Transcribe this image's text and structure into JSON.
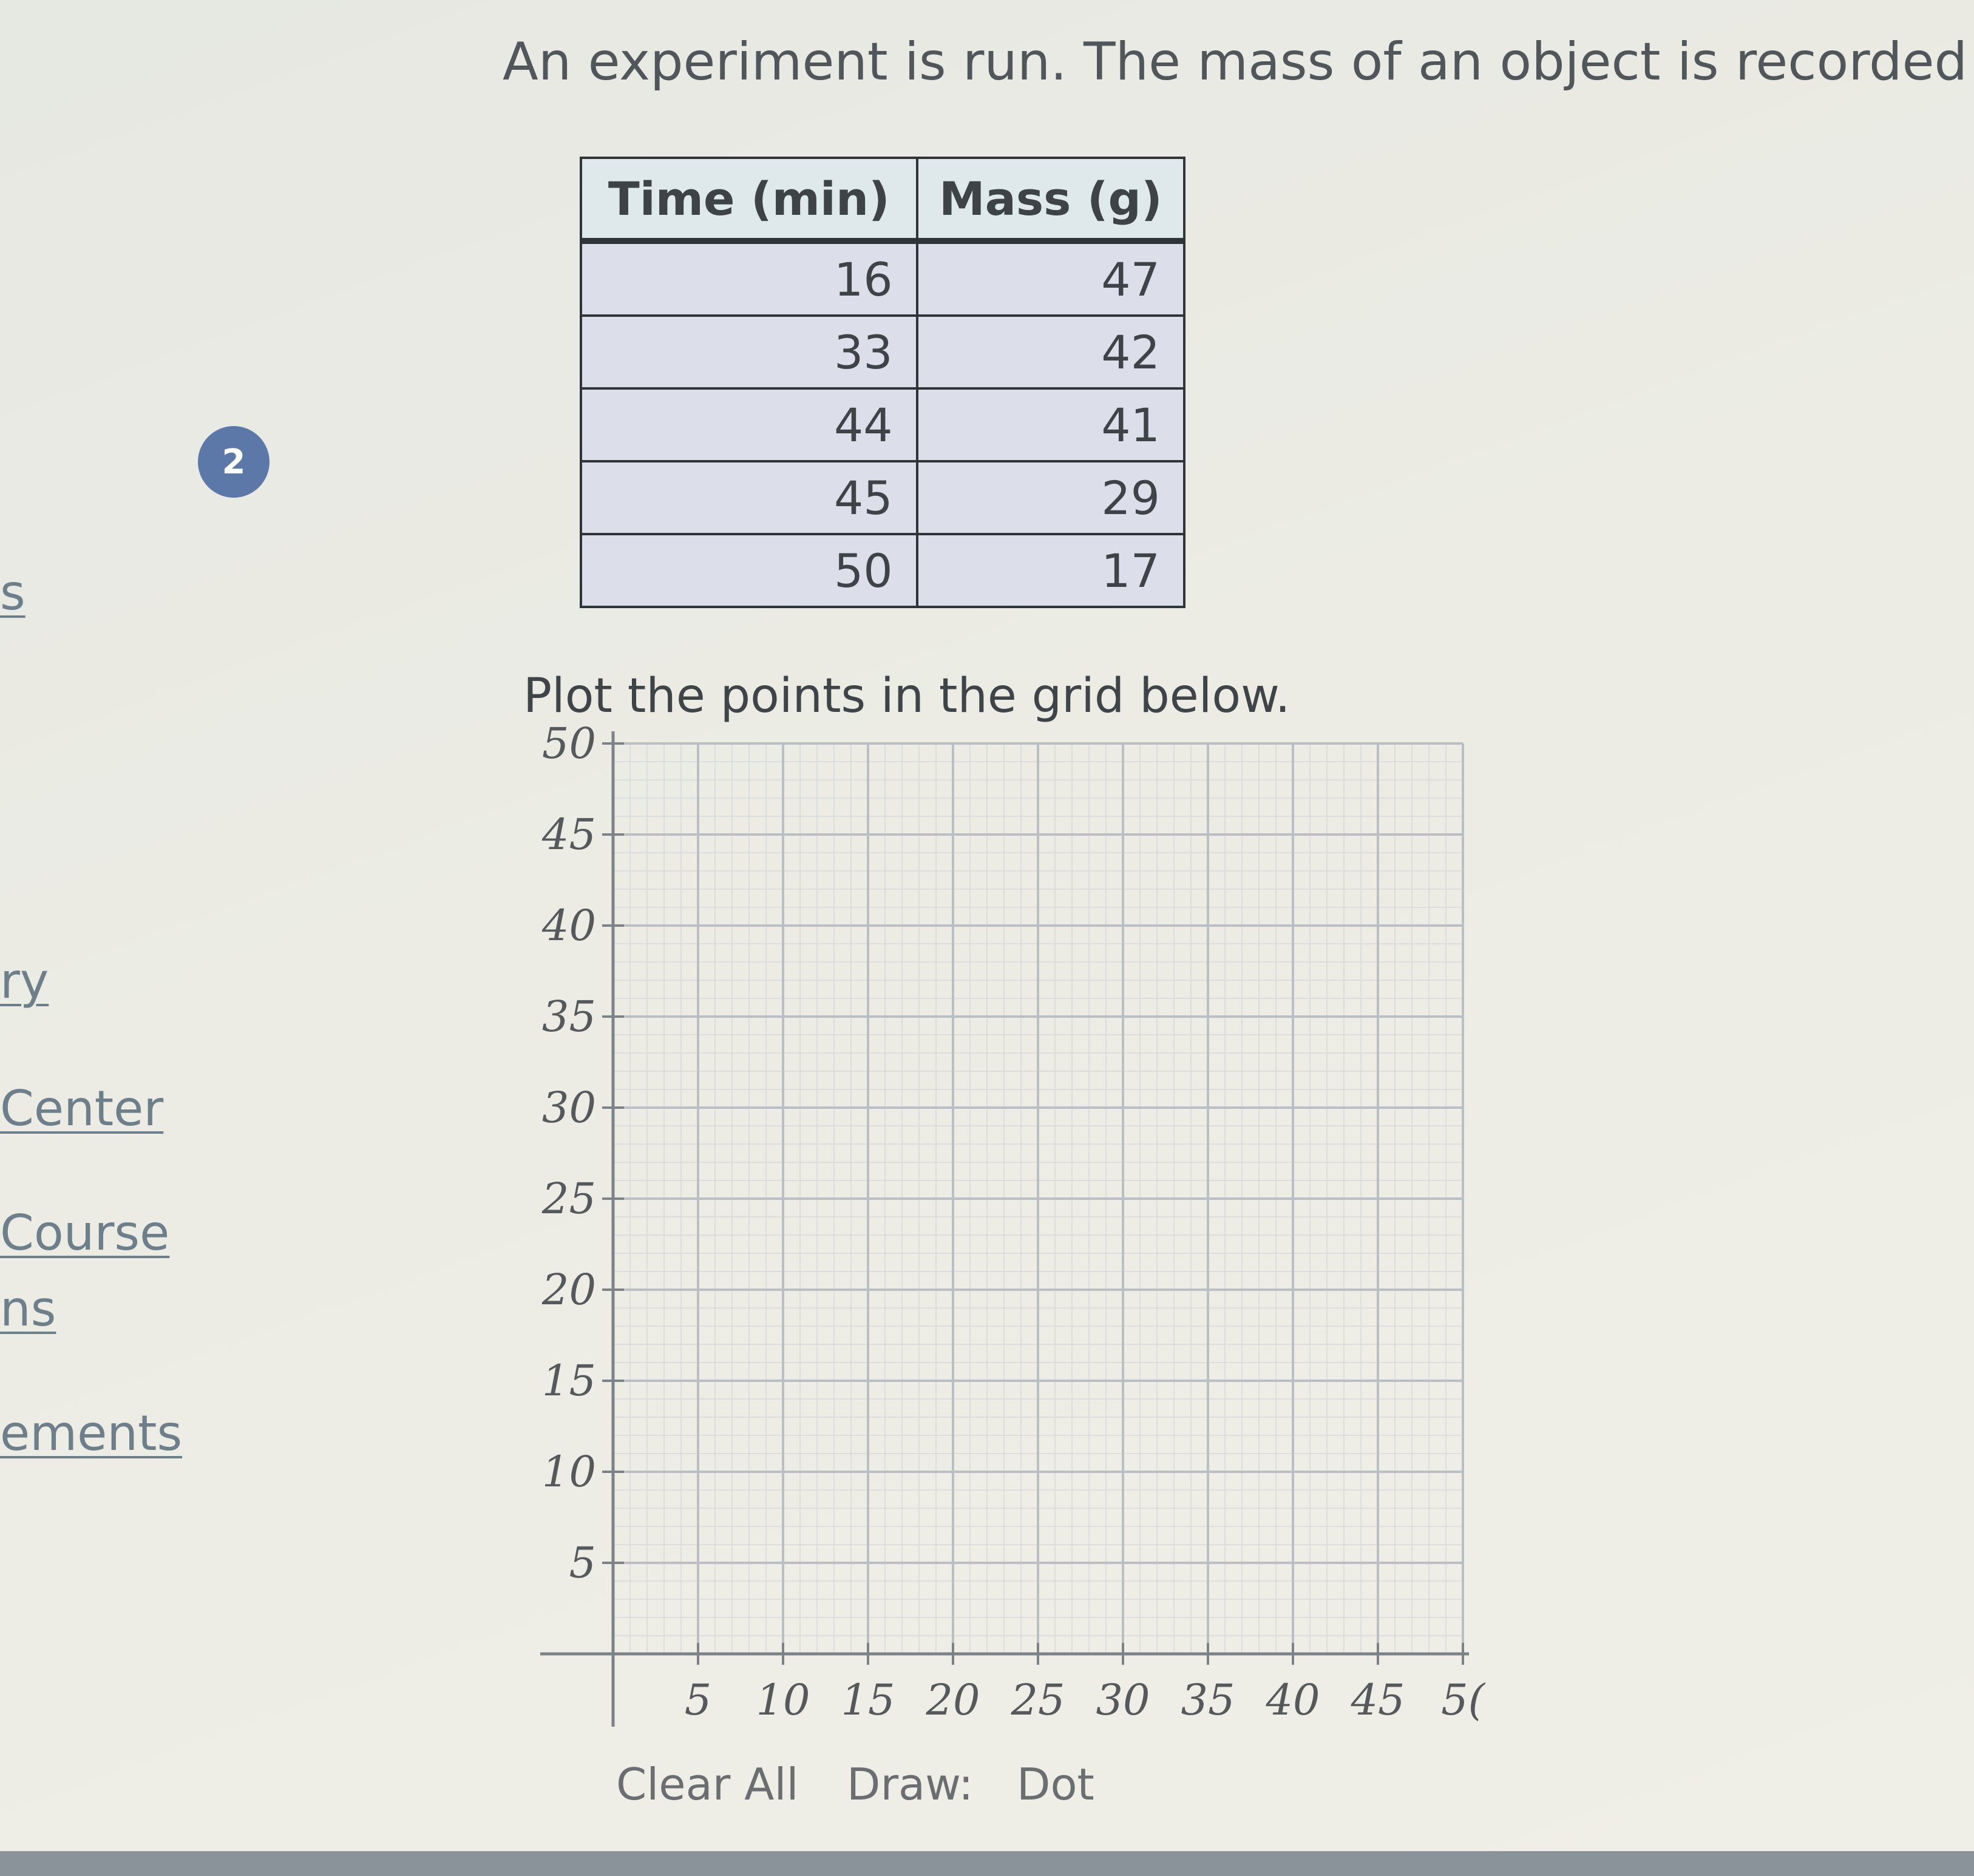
{
  "question": {
    "number": "2",
    "prompt": "An experiment is run. The mass of an object is recorded over tir"
  },
  "sidebar": {
    "items": [
      "s",
      "ry",
      "Center",
      "Course",
      "ns",
      "ements"
    ]
  },
  "table": {
    "headers": [
      "Time (min)",
      "Mass (g)"
    ],
    "rows": [
      [
        "16",
        "47"
      ],
      [
        "33",
        "42"
      ],
      [
        "44",
        "41"
      ],
      [
        "45",
        "29"
      ],
      [
        "50",
        "17"
      ]
    ]
  },
  "instruction": "Plot the points in the grid below.",
  "chart_data": {
    "type": "scatter",
    "x": [],
    "y": [],
    "xlim": [
      0,
      50
    ],
    "ylim": [
      0,
      50
    ],
    "xticks": [
      5,
      10,
      15,
      20,
      25,
      30,
      35,
      40,
      45,
      50
    ],
    "yticks": [
      5,
      10,
      15,
      20,
      25,
      30,
      35,
      40,
      45,
      50
    ],
    "xtick_labels": [
      "5",
      "10",
      "15",
      "20",
      "25",
      "30",
      "35",
      "40",
      "45",
      "5("
    ],
    "ytick_labels": [
      "5",
      "10",
      "15",
      "20",
      "25",
      "30",
      "35",
      "40",
      "45",
      "50"
    ],
    "minor_step": 1,
    "grid": true
  },
  "controls": {
    "clear_all": "Clear All",
    "draw_label": "Draw:",
    "draw_mode": "Dot"
  },
  "colors": {
    "badge": "#5b78a8",
    "link": "#6d7f8b",
    "grid_major": "#b9bfc4",
    "grid_minor": "#d6dadc",
    "axis": "#7c8388"
  }
}
